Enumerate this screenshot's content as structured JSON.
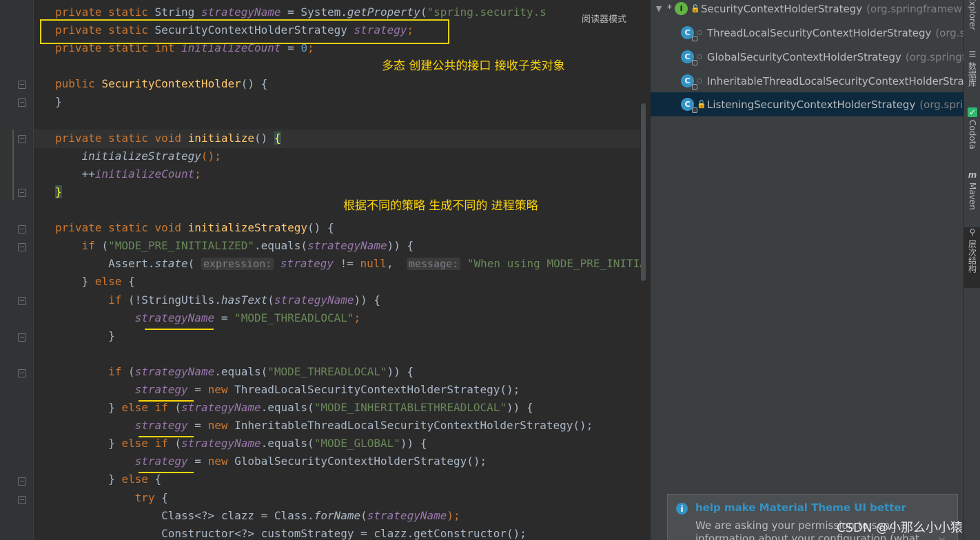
{
  "editor": {
    "reader_mode": "阅读器模式",
    "lines": [
      [
        {
          "t": "private static ",
          "c": "kw"
        },
        {
          "t": "String "
        },
        {
          "t": "strategyName",
          "c": "fld"
        },
        {
          "t": " = System."
        },
        {
          "t": "getProperty",
          "c": "sm"
        },
        {
          "t": "("
        },
        {
          "t": "\"spring.security.s",
          "c": "str"
        }
      ],
      [
        {
          "t": "private static ",
          "c": "kw"
        },
        {
          "t": "SecurityContextHolderStrategy "
        },
        {
          "t": "strategy",
          "c": "fld"
        },
        {
          "t": ";",
          "c": "kw"
        }
      ],
      [
        {
          "t": "private static int ",
          "c": "kw"
        },
        {
          "t": "initializeCount",
          "c": "fld"
        },
        {
          "t": " = "
        },
        {
          "t": "0",
          "c": "num"
        },
        {
          "t": ";",
          "c": "kw"
        }
      ],
      [],
      [
        {
          "t": "public ",
          "c": "kw"
        },
        {
          "t": "SecurityContextHolder",
          "c": "fn"
        },
        {
          "t": "() {"
        }
      ],
      [
        {
          "t": "}"
        }
      ],
      [],
      [
        {
          "t": "private static void ",
          "c": "kw"
        },
        {
          "t": "initialize",
          "c": "fn"
        },
        {
          "t": "() "
        },
        {
          "t": "{",
          "c": "brace-hl"
        }
      ],
      [
        {
          "t": "    "
        },
        {
          "t": "initializeStrategy",
          "c": "sm"
        },
        {
          "t": "();",
          "c": "kw"
        }
      ],
      [
        {
          "t": "    ++"
        },
        {
          "t": "initializeCount",
          "c": "fld"
        },
        {
          "t": ";",
          "c": "kw"
        }
      ],
      [
        {
          "t": "}",
          "c": "brace-hl"
        }
      ],
      [],
      [
        {
          "t": "private static void ",
          "c": "kw"
        },
        {
          "t": "initializeStrategy",
          "c": "fn"
        },
        {
          "t": "() {"
        }
      ],
      [
        {
          "t": "    "
        },
        {
          "t": "if ",
          "c": "kw"
        },
        {
          "t": "("
        },
        {
          "t": "\"MODE_PRE_INITIALIZED\"",
          "c": "str"
        },
        {
          "t": ".equals("
        },
        {
          "t": "strategyName",
          "c": "fld"
        },
        {
          "t": ")) {"
        }
      ],
      [
        {
          "t": "        Assert."
        },
        {
          "t": "state",
          "c": "sm"
        },
        {
          "t": "( "
        },
        {
          "t": "expression:",
          "c": "hint"
        },
        {
          "t": " "
        },
        {
          "t": "strategy",
          "c": "fld"
        },
        {
          "t": " != "
        },
        {
          "t": "null",
          "c": "kw"
        },
        {
          "t": ",  "
        },
        {
          "t": "message:",
          "c": "hint"
        },
        {
          "t": " "
        },
        {
          "t": "\"When using MODE_PRE_INITIA",
          "c": "str"
        }
      ],
      [
        {
          "t": "    } "
        },
        {
          "t": "else ",
          "c": "kw"
        },
        {
          "t": "{"
        }
      ],
      [
        {
          "t": "        "
        },
        {
          "t": "if ",
          "c": "kw"
        },
        {
          "t": "(!StringUtils."
        },
        {
          "t": "hasText",
          "c": "sm"
        },
        {
          "t": "("
        },
        {
          "t": "strategyName",
          "c": "fld"
        },
        {
          "t": ")) {"
        }
      ],
      [
        {
          "t": "            "
        },
        {
          "t": "strategyName",
          "c": "fld"
        },
        {
          "t": " = "
        },
        {
          "t": "\"MODE_THREADLOCAL\"",
          "c": "str"
        },
        {
          "t": ";",
          "c": "kw"
        }
      ],
      [
        {
          "t": "        }"
        }
      ],
      [],
      [
        {
          "t": "        "
        },
        {
          "t": "if ",
          "c": "kw"
        },
        {
          "t": "("
        },
        {
          "t": "strategyName",
          "c": "fld"
        },
        {
          "t": ".equals("
        },
        {
          "t": "\"MODE_THREADLOCAL\"",
          "c": "str"
        },
        {
          "t": ")) {"
        }
      ],
      [
        {
          "t": "            "
        },
        {
          "t": "strategy",
          "c": "fld"
        },
        {
          "t": " = "
        },
        {
          "t": "new ",
          "c": "kw"
        },
        {
          "t": "ThreadLocalSecurityContextHolderStrategy();"
        }
      ],
      [
        {
          "t": "        } "
        },
        {
          "t": "else if ",
          "c": "kw"
        },
        {
          "t": "("
        },
        {
          "t": "strategyName",
          "c": "fld"
        },
        {
          "t": ".equals("
        },
        {
          "t": "\"MODE_INHERITABLETHREADLOCAL\"",
          "c": "str"
        },
        {
          "t": ")) {"
        }
      ],
      [
        {
          "t": "            "
        },
        {
          "t": "strategy",
          "c": "fld"
        },
        {
          "t": " = "
        },
        {
          "t": "new ",
          "c": "kw"
        },
        {
          "t": "InheritableThreadLocalSecurityContextHolderStrategy();"
        }
      ],
      [
        {
          "t": "        } "
        },
        {
          "t": "else if ",
          "c": "kw"
        },
        {
          "t": "("
        },
        {
          "t": "strategyName",
          "c": "fld"
        },
        {
          "t": ".equals("
        },
        {
          "t": "\"MODE_GLOBAL\"",
          "c": "str"
        },
        {
          "t": ")) {"
        }
      ],
      [
        {
          "t": "            "
        },
        {
          "t": "strategy",
          "c": "fld"
        },
        {
          "t": " = "
        },
        {
          "t": "new ",
          "c": "kw"
        },
        {
          "t": "GlobalSecurityContextHolderStrategy();"
        }
      ],
      [
        {
          "t": "        } "
        },
        {
          "t": "else ",
          "c": "kw"
        },
        {
          "t": "{"
        }
      ],
      [
        {
          "t": "            "
        },
        {
          "t": "try ",
          "c": "kw"
        },
        {
          "t": "{"
        }
      ],
      [
        {
          "t": "                Class<?> clazz = Class."
        },
        {
          "t": "forName",
          "c": "sm"
        },
        {
          "t": "("
        },
        {
          "t": "strategyName",
          "c": "fld"
        },
        {
          "t": ");",
          "c": "kw"
        }
      ],
      [
        {
          "t": "                Constructor<?> customStrategy = clazz.getConstructor();"
        }
      ]
    ]
  },
  "annotations": {
    "polymorphism": "多态  创建公共的接口 接收子类对象",
    "strategy_note": "根据不同的策略 生成不同的 进程策略"
  },
  "hierarchy": {
    "root": {
      "name": "SecurityContextHolderStrategy",
      "package": "(org.springframew"
    },
    "children": [
      {
        "name": "ThreadLocalSecurityContextHolderStrategy",
        "package": "(org.s"
      },
      {
        "name": "GlobalSecurityContextHolderStrategy",
        "package": "(org.springf"
      },
      {
        "name": "InheritableThreadLocalSecurityContextHolderStra",
        "package": ""
      },
      {
        "name": "ListeningSecurityContextHolderStrategy",
        "package": "(org.sprin"
      }
    ]
  },
  "tool_strip": {
    "explorer": "Explorer",
    "database": "数据库",
    "codota": "Codota",
    "maven": "Maven",
    "hierarchy": "层次结构"
  },
  "notification": {
    "title": "help make Material Theme UI better",
    "body": "We are asking your permission to send information about your configuration (what"
  },
  "watermark": "CSDN @小那么小小猿",
  "colors": {
    "keyword": "#cc7832",
    "field": "#9876aa",
    "string": "#6a8759",
    "method": "#ffc66d",
    "annotation": "#ffd60a"
  }
}
